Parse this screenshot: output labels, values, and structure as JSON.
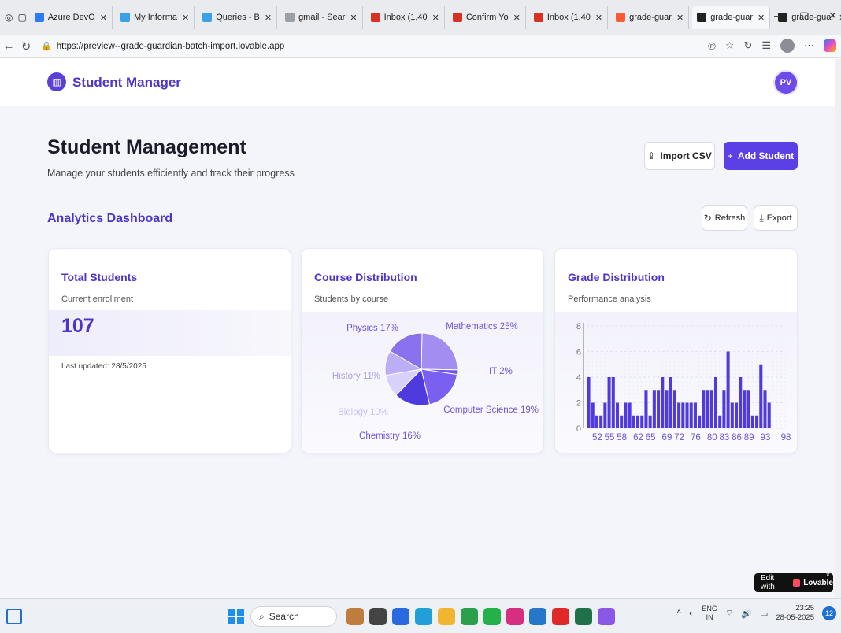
{
  "browser": {
    "tabs": [
      {
        "label": "Azure DevO",
        "color": "#2b7cf7"
      },
      {
        "label": "My Informa",
        "color": "#3aa1e6"
      },
      {
        "label": "Queries - B",
        "color": "#3aa1e6"
      },
      {
        "label": "gmail - Sear",
        "color": "#9aa0a6"
      },
      {
        "label": "Inbox (1,40",
        "color": "#d93025"
      },
      {
        "label": "Confirm Yo",
        "color": "#d93025"
      },
      {
        "label": "Inbox (1,40",
        "color": "#d93025"
      },
      {
        "label": "grade-guar",
        "color": "#ff5a36"
      },
      {
        "label": "grade-guar",
        "color": "#222222"
      },
      {
        "label": "grade-guar",
        "color": "#222222"
      }
    ],
    "url": "https://preview--grade-guardian-batch-import.lovable.app"
  },
  "app": {
    "brand": "Student Manager",
    "avatar_initials": "PV"
  },
  "page": {
    "title": "Student Management",
    "subtitle": "Manage your students efficiently and track their progress",
    "import_label": "Import CSV",
    "add_label": "Add Student"
  },
  "analytics": {
    "title": "Analytics Dashboard",
    "refresh_label": "Refresh",
    "export_label": "Export"
  },
  "cards": {
    "total": {
      "title": "Total Students",
      "subtitle": "Current enrollment",
      "value": "107",
      "updated": "Last updated: 28/5/2025"
    },
    "course": {
      "title": "Course Distribution",
      "subtitle": "Students by course"
    },
    "grade": {
      "title": "Grade Distribution",
      "subtitle": "Performance analysis"
    }
  },
  "chart_data": [
    {
      "type": "pie",
      "title": "Course Distribution",
      "slices": [
        {
          "label": "Mathematics",
          "percent": 25,
          "text": "Mathematics 25%",
          "color": "#a48df0"
        },
        {
          "label": "IT",
          "percent": 2,
          "text": "IT 2%",
          "color": "#6f55ea"
        },
        {
          "label": "Computer Science",
          "percent": 19,
          "text": "Computer Science 19%",
          "color": "#7a60ee"
        },
        {
          "label": "Chemistry",
          "percent": 16,
          "text": "Chemistry 16%",
          "color": "#4f3bdd"
        },
        {
          "label": "Biology",
          "percent": 10,
          "text": "Biology 10%",
          "color": "#d8d1fb"
        },
        {
          "label": "History",
          "percent": 11,
          "text": "History 11%",
          "color": "#bcaef6"
        },
        {
          "label": "Physics",
          "percent": 17,
          "text": "Physics 17%",
          "color": "#8a72ee"
        }
      ]
    },
    {
      "type": "bar",
      "title": "Grade Distribution",
      "x_start": 50,
      "x": [
        50,
        51,
        52,
        53,
        54,
        55,
        56,
        57,
        58,
        59,
        60,
        61,
        62,
        63,
        64,
        65,
        66,
        67,
        68,
        69,
        70,
        71,
        72,
        73,
        74,
        75,
        76,
        77,
        78,
        79,
        80,
        81,
        82,
        83,
        84,
        85,
        86,
        87,
        88,
        89,
        90,
        91,
        92,
        93,
        94,
        95,
        96,
        97,
        98
      ],
      "values": [
        4,
        2,
        1,
        1,
        2,
        4,
        4,
        2,
        1,
        2,
        2,
        1,
        1,
        1,
        3,
        1,
        3,
        3,
        4,
        3,
        4,
        3,
        2,
        2,
        2,
        2,
        2,
        1,
        3,
        3,
        3,
        4,
        1,
        3,
        6,
        2,
        2,
        4,
        3,
        3,
        1,
        1,
        5,
        3,
        2,
        0,
        0,
        0,
        0
      ],
      "xticks": [
        52,
        55,
        58,
        62,
        65,
        69,
        72,
        76,
        80,
        83,
        86,
        89,
        93,
        98
      ],
      "yticks": [
        0,
        2,
        4,
        6,
        8
      ],
      "ylim": [
        0,
        8
      ],
      "grid": true,
      "color": "#4f3bdd"
    }
  ],
  "lovable": {
    "prefix": "Edit with",
    "brand": "Lovable"
  },
  "taskbar": {
    "search_label": "Search",
    "lang_1": "ENG",
    "lang_2": "IN",
    "time": "23:25",
    "date": "28-05-2025",
    "notifications": "12",
    "apps": [
      {
        "name": "app-1",
        "color": "#c07c3e"
      },
      {
        "name": "app-2",
        "color": "#444444"
      },
      {
        "name": "app-3",
        "color": "#2a6ae0"
      },
      {
        "name": "app-4",
        "color": "#21a0d8"
      },
      {
        "name": "app-5",
        "color": "#f1b530"
      },
      {
        "name": "app-6",
        "color": "#2b9f4c"
      },
      {
        "name": "app-7",
        "color": "#25b04a"
      },
      {
        "name": "app-8",
        "color": "#d62f7f"
      },
      {
        "name": "app-9",
        "color": "#2677c9"
      },
      {
        "name": "app-10",
        "color": "#e02828"
      },
      {
        "name": "app-11",
        "color": "#20704a"
      },
      {
        "name": "app-12",
        "color": "#8a57e6"
      }
    ]
  }
}
